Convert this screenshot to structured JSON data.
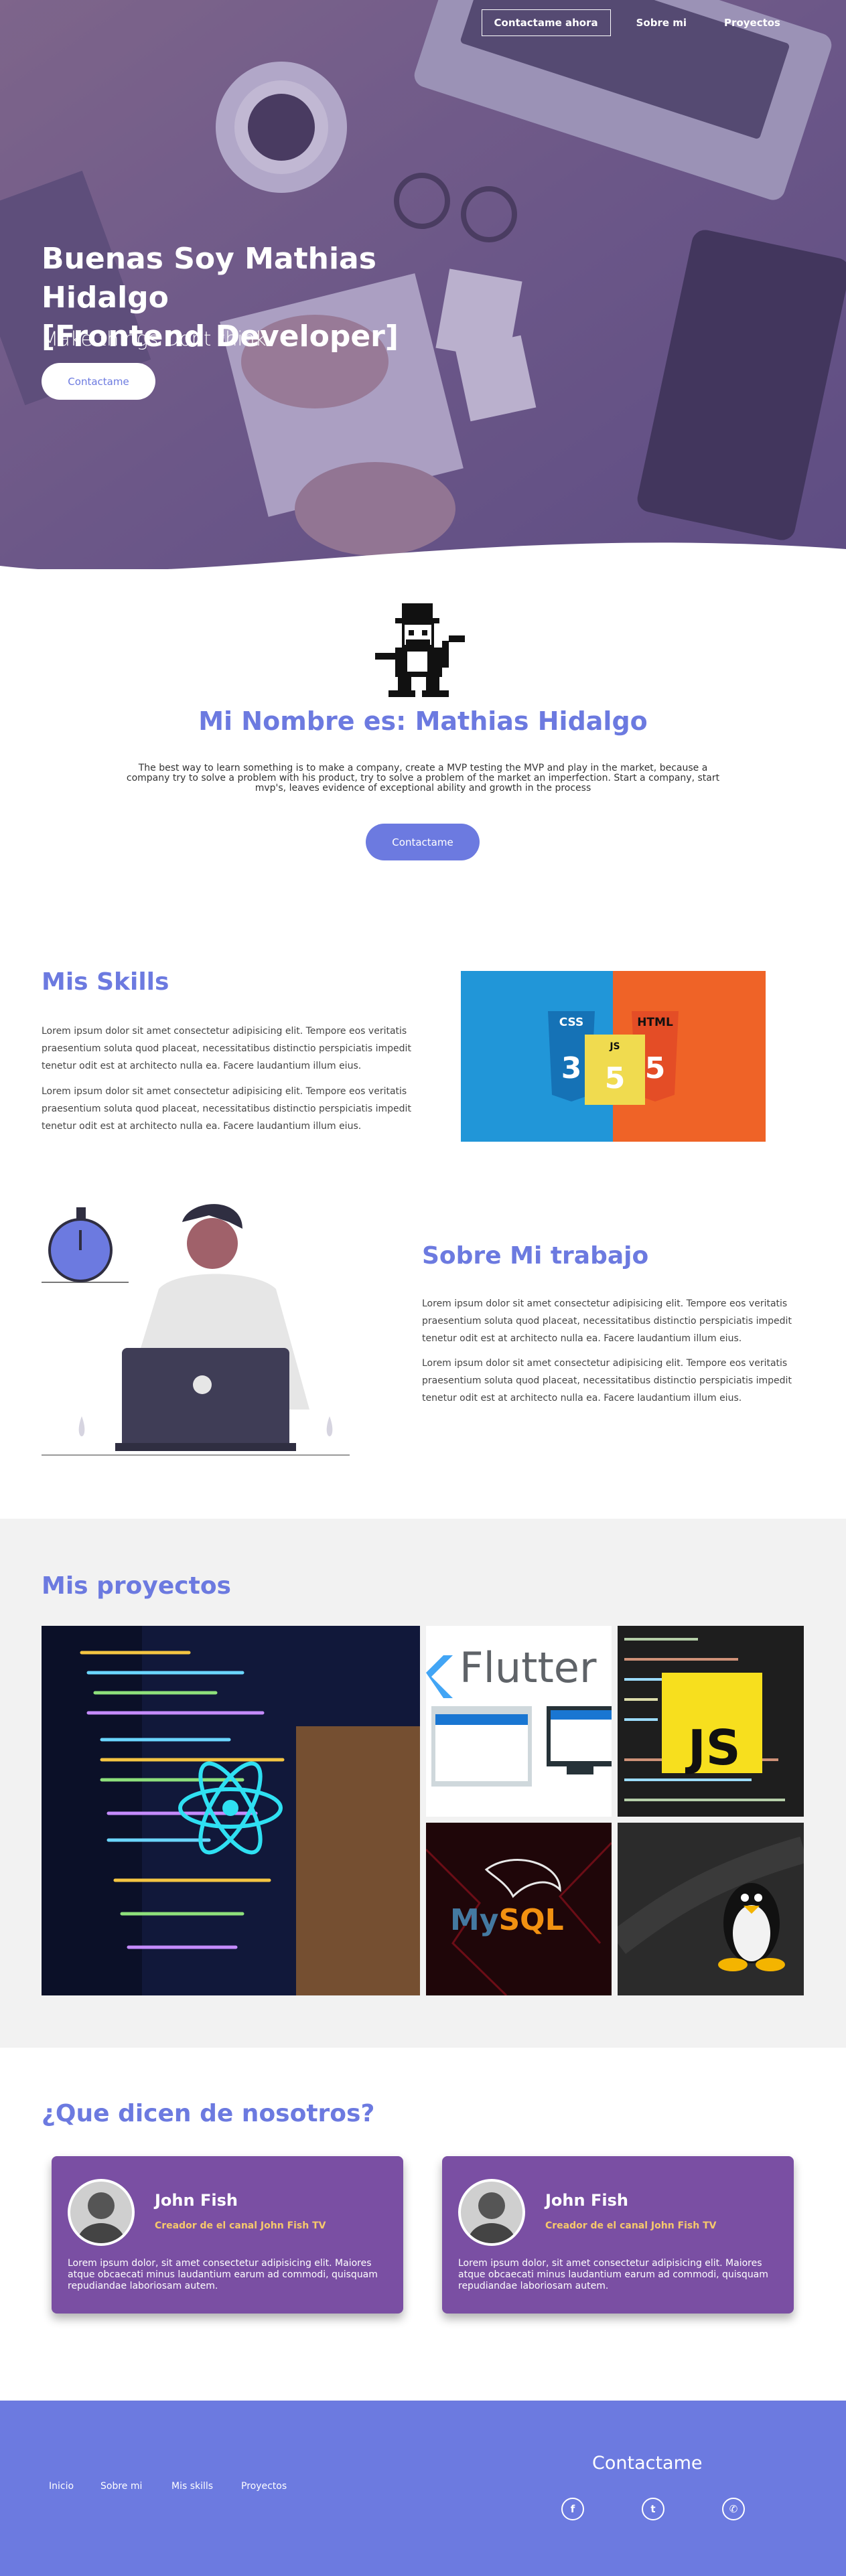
{
  "nav": {
    "contact": "Contactame ahora",
    "about": "Sobre mi",
    "projects": "Proyectos"
  },
  "hero": {
    "title_line1": "Buenas Soy Mathias Hidalgo",
    "title_line2": "[Frontend Developer]",
    "subtitle": "Make things Dont think",
    "button": "Contactame"
  },
  "about": {
    "title": "Mi Nombre es: Mathias Hidalgo",
    "text": "The best way to learn something is to make a company, create a MVP testing the MVP and play in the market, because a company try to solve a problem with his product, try to solve a problem of the market an imperfection. Start a company, start mvp's, leaves evidence of exceptional ability and growth in the process",
    "button": "Contactame"
  },
  "skills": {
    "title": "Mis Skills",
    "p1": "Lorem ipsum dolor sit amet consectetur adipisicing elit. Tempore eos veritatis praesentium soluta quod placeat, necessitatibus distinctio perspiciatis impedit tenetur odit est at architecto nulla ea. Facere laudantium illum eius.",
    "p2": "Lorem ipsum dolor sit amet consectetur adipisicing elit. Tempore eos veritatis praesentium soluta quod placeat, necessitatibus distinctio perspiciatis impedit tenetur odit est at architecto nulla ea. Facere laudantium illum eius.",
    "badge_css": "CSS",
    "badge_html": "HTML",
    "badge_js": "JS"
  },
  "work": {
    "title": "Sobre Mi trabajo",
    "p1": "Lorem ipsum dolor sit amet consectetur adipisicing elit. Tempore eos veritatis praesentium soluta quod placeat, necessitatibus distinctio perspiciatis impedit tenetur odit est at architecto nulla ea. Facere laudantium illum eius.",
    "p2": "Lorem ipsum dolor sit amet consectetur adipisicing elit. Tempore eos veritatis praesentium soluta quod placeat, necessitatibus distinctio perspiciatis impedit tenetur odit est at architecto nulla ea. Facere laudantium illum eius."
  },
  "projects": {
    "title": "Mis proyectos",
    "flutter": "Flutter",
    "js": "JS",
    "mysql": "MySQL",
    "my": "My",
    "sql": "SQL"
  },
  "testimonials": {
    "title": "¿Que dicen de nosotros?",
    "items": [
      {
        "name": "John Fish",
        "role": "Creador de el canal John Fish TV",
        "text": "Lorem ipsum dolor, sit amet consectetur adipisicing elit. Maiores atque obcaecati minus laudantium earum ad commodi, quisquam repudiandae laboriosam autem."
      },
      {
        "name": "John Fish",
        "role": "Creador de el canal John Fish TV",
        "text": "Lorem ipsum dolor, sit amet consectetur adipisicing elit. Maiores atque obcaecati minus laudantium earum ad commodi, quisquam repudiandae laboriosam autem."
      }
    ]
  },
  "footer": {
    "links": [
      "Inicio",
      "Sobre mi",
      "Mis skills",
      "Proyectos"
    ],
    "contact_title": "Contactame",
    "icons": [
      "facebook-icon",
      "twitter-icon",
      "whatsapp-icon"
    ]
  },
  "colors": {
    "accent": "#6c7ae0",
    "card": "#7a4fa3",
    "role": "#f7c96b",
    "projects_bg": "#f2f2f2"
  }
}
